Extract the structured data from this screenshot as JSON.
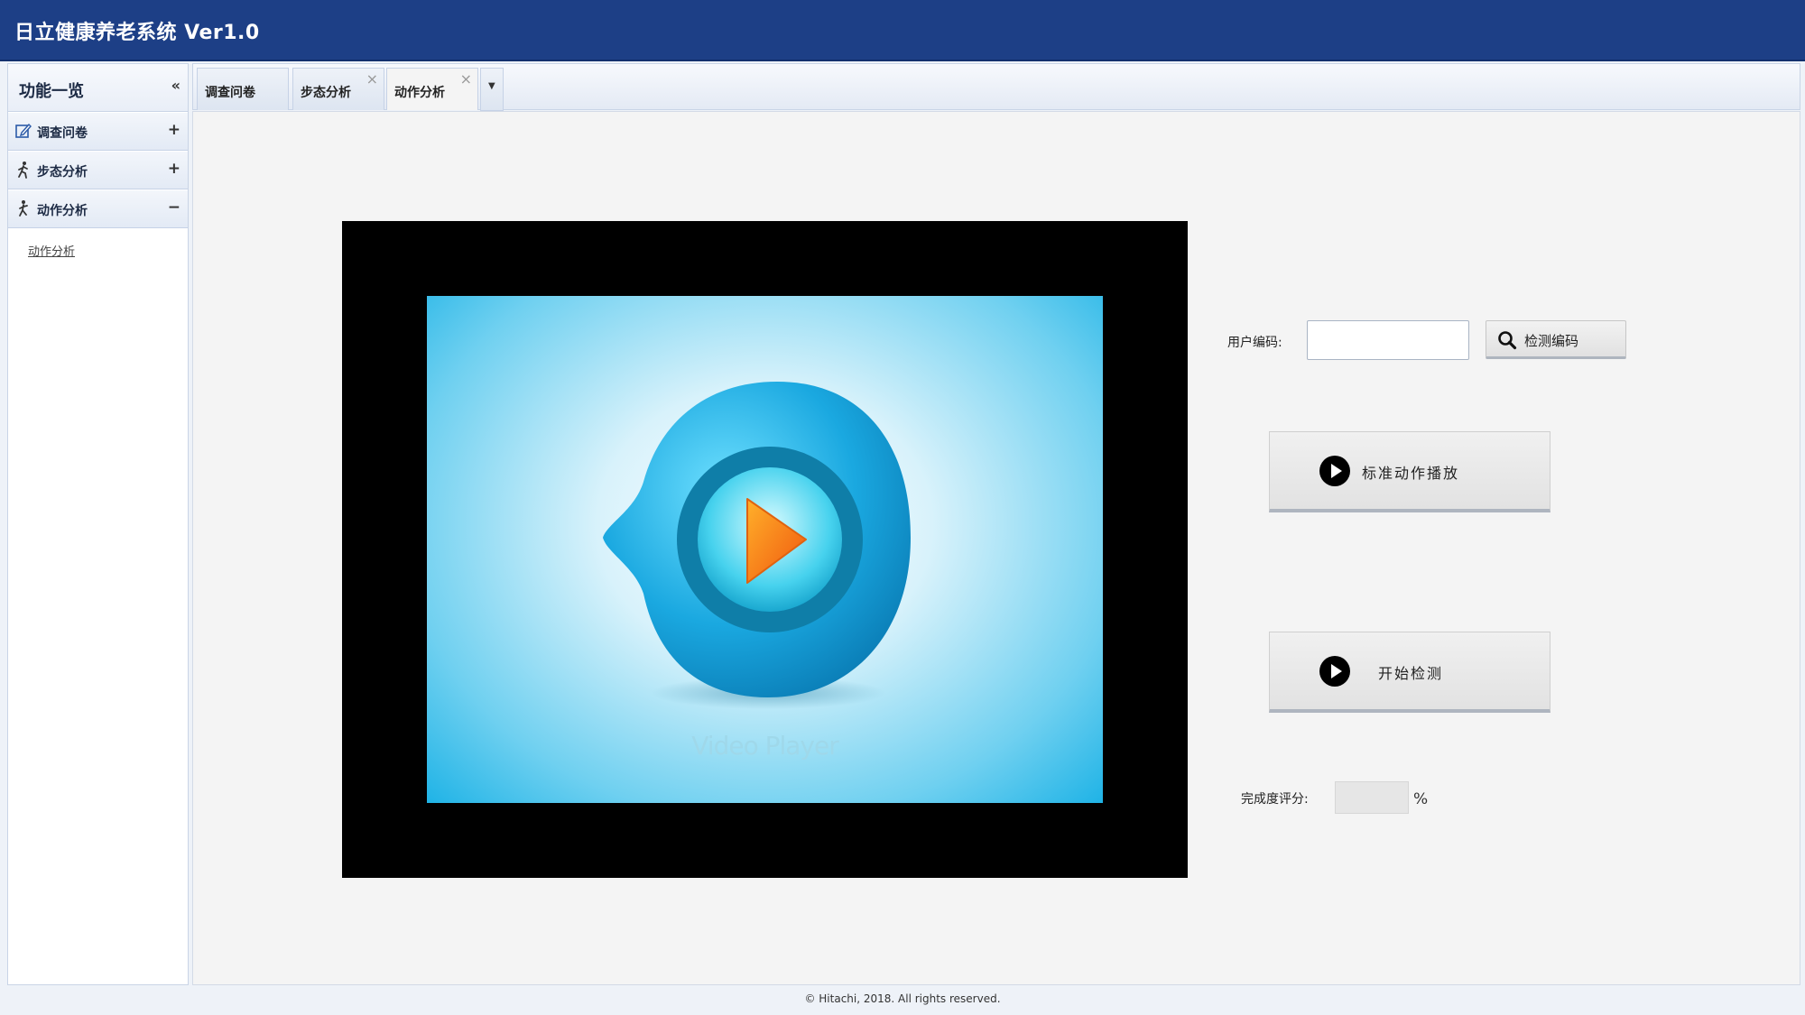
{
  "app": {
    "title": "日立健康养老系统 Ver1.0"
  },
  "sidebar": {
    "title": "功能一览",
    "collapse_symbol": "«",
    "groups": [
      {
        "label": "调查问卷",
        "icon": "edit-icon",
        "toggle": "+"
      },
      {
        "label": "步态分析",
        "icon": "walking-person-icon",
        "toggle": "+"
      },
      {
        "label": "动作分析",
        "icon": "walking-person-icon",
        "toggle": "−"
      }
    ],
    "submenu": {
      "label": "动作分析"
    }
  },
  "tabs": {
    "items": [
      {
        "label": "调查问卷",
        "closable": false
      },
      {
        "label": "步态分析",
        "closable": true,
        "close_symbol": "×"
      },
      {
        "label": "动作分析",
        "closable": true,
        "close_symbol": "×",
        "active": true
      }
    ],
    "more_symbol": "▼"
  },
  "video": {
    "caption": "Video Player"
  },
  "form": {
    "user_code_label": "用户编码:",
    "user_code_value": "",
    "search_button_label": "检测编码",
    "standard_play_label": "标准动作播放",
    "start_detect_label": "开始检测",
    "score_label": "完成度评分:",
    "score_value": "",
    "percent_sign": "%"
  },
  "footer": {
    "text": "© Hitachi, 2018. All rights reserved."
  },
  "colors": {
    "header": "#1d3f86",
    "video_bg": "#000000",
    "accent_blue": "#1fb3e6",
    "play_orange": "#f58a1f"
  }
}
